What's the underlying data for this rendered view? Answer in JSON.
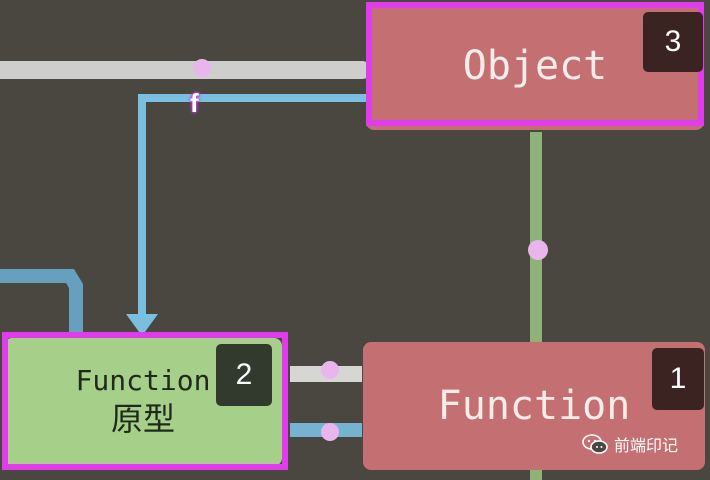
{
  "nodes": {
    "object": {
      "label": "Object",
      "badge": "3"
    },
    "function": {
      "label": "Function",
      "badge": "1"
    },
    "function_prototype": {
      "label_line1": "Function",
      "label_line2": "原型",
      "badge": "2"
    }
  },
  "edge_label": "f",
  "watermark": {
    "text": "前端印记",
    "icon": "wechat-icon"
  },
  "colors": {
    "background": "#4a4741",
    "red_node": "#c46f72",
    "green_node": "#a6cf8a",
    "highlight": "#e03cec",
    "blue_line": "#7bbfe0",
    "green_line": "#8fb27a",
    "white_line": "#e6e6e6"
  }
}
